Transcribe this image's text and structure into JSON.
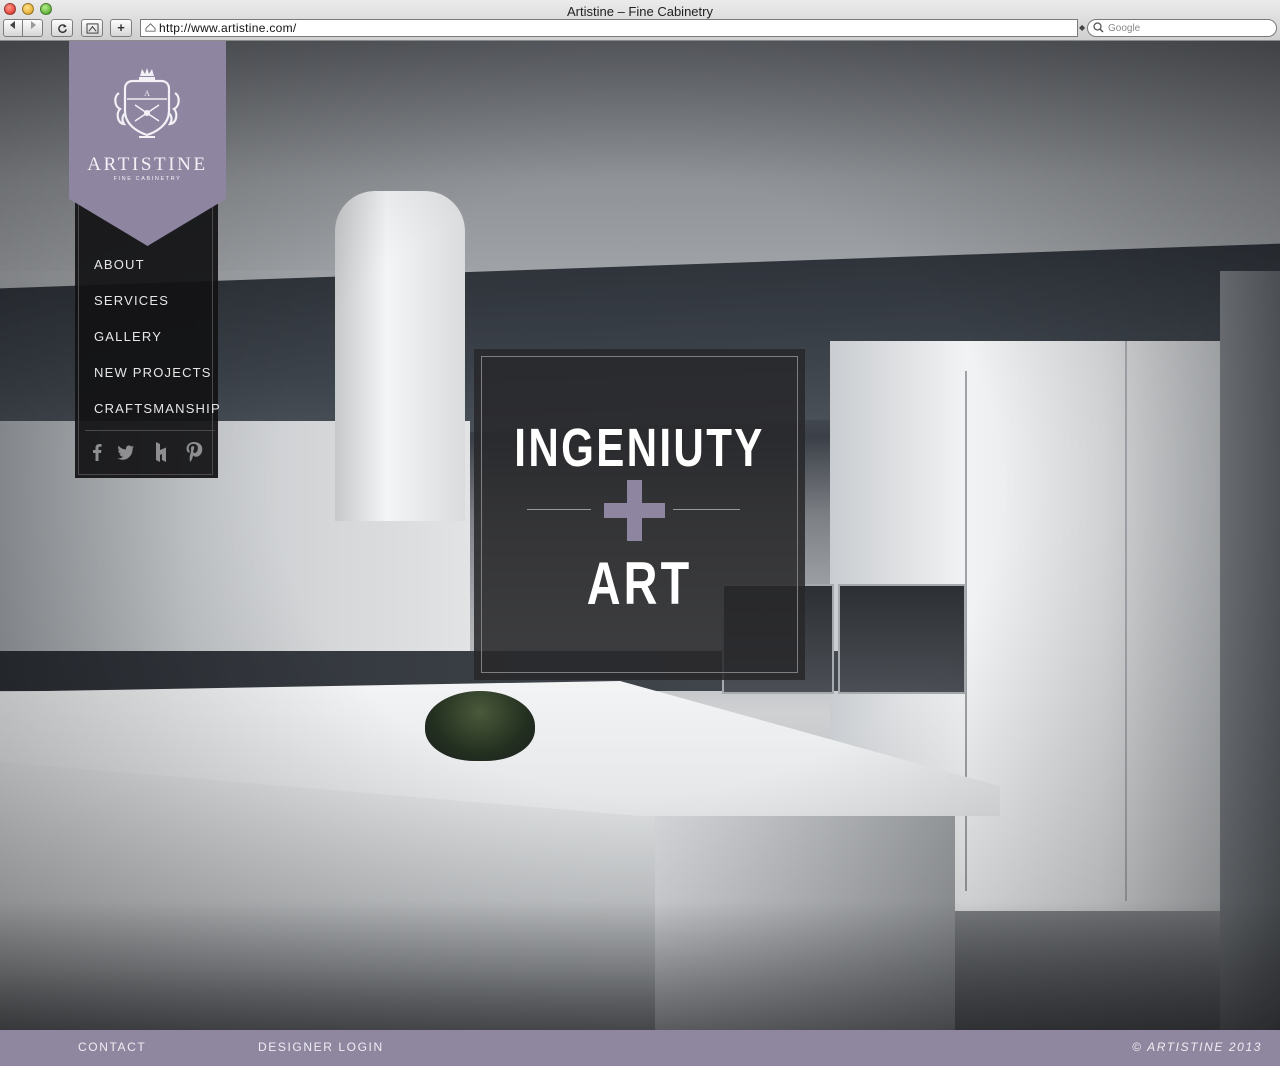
{
  "browser": {
    "window_title": "Artistine – Fine Cabinetry",
    "url": "http://www.artistine.com/",
    "search_placeholder": "Google",
    "add_label": "+"
  },
  "logo": {
    "name": "ARTISTINE",
    "tagline": "FINE CABINETRY"
  },
  "nav": {
    "items": [
      "ABOUT",
      "SERVICES",
      "GALLERY",
      "NEW PROJECTS",
      "CRAFTSMANSHIP"
    ],
    "social": [
      "facebook-icon",
      "twitter-icon",
      "houzz-icon",
      "pinterest-icon"
    ]
  },
  "hero": {
    "headline_top": "INGENIUTY",
    "headline_bottom": "ART",
    "accent_color": "#8e85a1"
  },
  "footer": {
    "contact": "CONTACT",
    "designer_login": "DESIGNER LOGIN",
    "copyright": "© ARTISTINE 2013"
  }
}
